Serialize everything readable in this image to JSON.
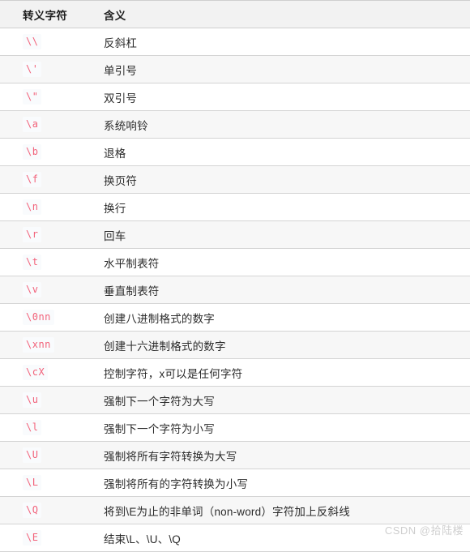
{
  "table": {
    "headers": {
      "char": "转义字符",
      "meaning": "含义"
    },
    "rows": [
      {
        "char": "\\\\",
        "meaning": "反斜杠"
      },
      {
        "char": "\\'",
        "meaning": "单引号"
      },
      {
        "char": "\\\"",
        "meaning": "双引号"
      },
      {
        "char": "\\a",
        "meaning": "系统响铃"
      },
      {
        "char": "\\b",
        "meaning": "退格"
      },
      {
        "char": "\\f",
        "meaning": "换页符"
      },
      {
        "char": "\\n",
        "meaning": "换行"
      },
      {
        "char": "\\r",
        "meaning": "回车"
      },
      {
        "char": "\\t",
        "meaning": "水平制表符"
      },
      {
        "char": "\\v",
        "meaning": "垂直制表符"
      },
      {
        "char": "\\0nn",
        "meaning": "创建八进制格式的数字"
      },
      {
        "char": "\\xnn",
        "meaning": "创建十六进制格式的数字"
      },
      {
        "char": "\\cX",
        "meaning": "控制字符，x可以是任何字符"
      },
      {
        "char": "\\u",
        "meaning": "强制下一个字符为大写"
      },
      {
        "char": "\\l",
        "meaning": "强制下一个字符为小写"
      },
      {
        "char": "\\U",
        "meaning": "强制将所有字符转换为大写"
      },
      {
        "char": "\\L",
        "meaning": "强制将所有的字符转换为小写"
      },
      {
        "char": "\\Q",
        "meaning": "将到\\E为止的非单词（non-word）字符加上反斜线"
      },
      {
        "char": "\\E",
        "meaning": "结束\\L、\\U、\\Q"
      }
    ]
  },
  "watermark": {
    "text": "CSDN @拾陆楼"
  },
  "colors": {
    "header_bg": "#f2f2f2",
    "row_alt_bg": "#f7f7f7",
    "border": "#d4d4d4",
    "code_text": "#f2627a",
    "code_bg": "#f9fbfd",
    "text": "#2b2b2b",
    "watermark": "#cfcfcf"
  }
}
